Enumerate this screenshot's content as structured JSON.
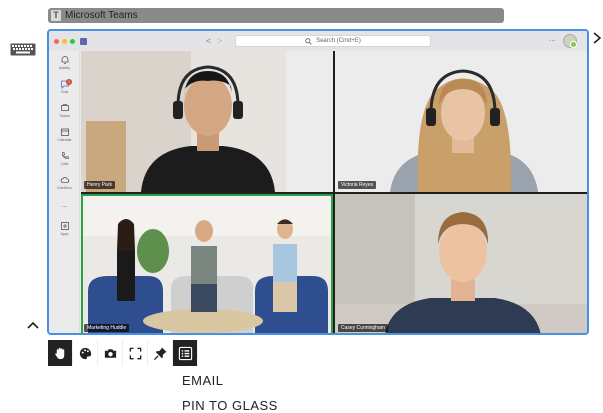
{
  "window": {
    "title": "Microsoft Teams",
    "app_icon_letter": "T"
  },
  "browser": {
    "search_placeholder": "Search (Cmd+E)",
    "more": "..."
  },
  "rail": {
    "items": [
      {
        "label": "Activity"
      },
      {
        "label": "Chat",
        "badge": "1"
      },
      {
        "label": "Teams"
      },
      {
        "label": "Calendar"
      },
      {
        "label": "Calls"
      },
      {
        "label": "OneDrive"
      },
      {
        "label": "..."
      },
      {
        "label": "Apps"
      }
    ]
  },
  "participants": [
    {
      "name": "Henry Park"
    },
    {
      "name": "Victoria Reyes"
    },
    {
      "name": "Marketing Huddle"
    },
    {
      "name": "Casey Cunningham"
    }
  ],
  "colors": {
    "accent": "#4a90e2",
    "active_speaker": "#2ea043",
    "teams": "#5b5fc7"
  },
  "toolbar": {
    "icons": [
      "hand-icon",
      "palette-icon",
      "camera-icon",
      "fullscreen-icon",
      "pin-icon",
      "list-icon"
    ]
  },
  "menu": {
    "items": [
      "EMAIL",
      "PIN TO GLASS"
    ]
  }
}
